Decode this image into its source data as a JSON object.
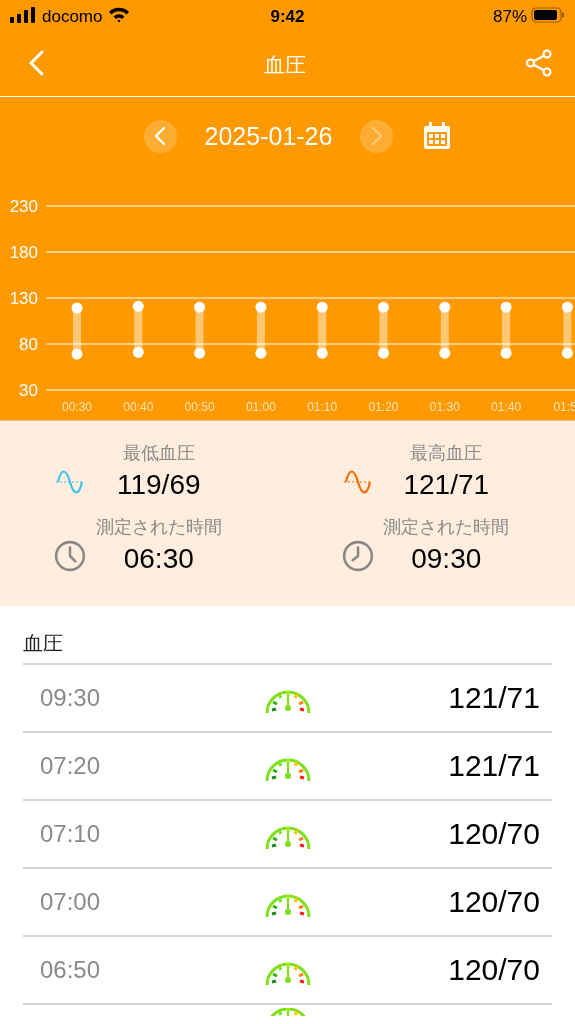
{
  "status_bar": {
    "carrier": "docomo",
    "time": "9:42",
    "battery": "87%"
  },
  "nav": {
    "title": "血圧"
  },
  "date_picker": {
    "date": "2025-01-26",
    "next_disabled": true
  },
  "chart": {
    "chart_data": {
      "type": "scatter",
      "categories": [
        "00:30",
        "00:40",
        "00:50",
        "01:00",
        "01:10",
        "01:20",
        "01:30",
        "01:40",
        "01:5"
      ],
      "ylim": [
        30,
        230
      ],
      "grid": true,
      "yticks": [
        30,
        80,
        130,
        180,
        230
      ],
      "series": [
        {
          "color": "#ffffff",
          "values": [
            119,
            121,
            120,
            120,
            120,
            120,
            120,
            120,
            120
          ]
        },
        {
          "color": "#ffffff",
          "values": [
            69,
            71,
            70,
            70,
            70,
            70,
            70,
            70,
            70
          ]
        }
      ]
    }
  },
  "summary": [
    {
      "kind": "low",
      "label": "最低血圧",
      "value": "119/69",
      "time_label": "測定された時間",
      "time": "06:30"
    },
    {
      "kind": "high",
      "label": "最高血圧",
      "value": "121/71",
      "time_label": "測定された時間",
      "time": "09:30"
    }
  ],
  "list": {
    "title": "血圧",
    "rows": [
      {
        "time": "09:30",
        "value": "121/71"
      },
      {
        "time": "07:20",
        "value": "121/71"
      },
      {
        "time": "07:10",
        "value": "120/70"
      },
      {
        "time": "07:00",
        "value": "120/70"
      },
      {
        "time": "06:50",
        "value": "120/70"
      }
    ],
    "peek": true
  }
}
